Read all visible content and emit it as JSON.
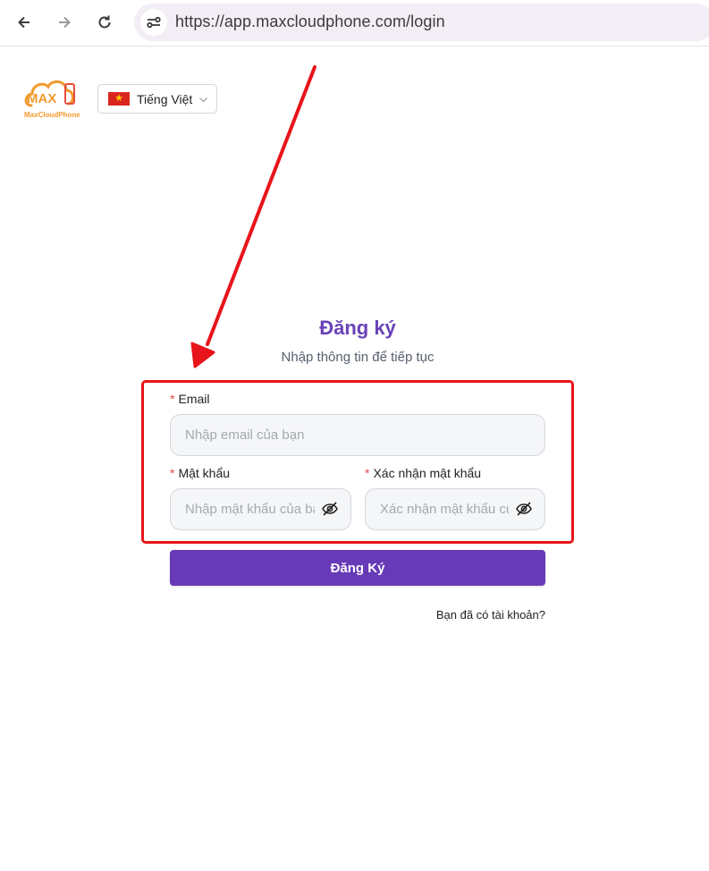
{
  "browser": {
    "url": "https://app.maxcloudphone.com/login"
  },
  "logo": {
    "badge": "MAX",
    "brand": "MaxCloudPhone"
  },
  "language": {
    "selected": "Tiếng Việt",
    "flag_star": "★"
  },
  "form": {
    "title": "Đăng ký",
    "subtitle": "Nhập thông tin để tiếp tục",
    "required_mark": "*",
    "email_label": "Email",
    "email_placeholder": "Nhập email của bạn",
    "password_label": "Mật khẩu",
    "password_placeholder": "Nhập mật khẩu của bạn",
    "confirm_label": "Xác nhận mật khẩu",
    "confirm_placeholder": "Xác nhận mật khẩu của bạn",
    "submit_label": "Đăng Ký",
    "login_link": "Bạn đã có tài khoản?"
  },
  "colors": {
    "accent": "#673ab7",
    "title": "#6a42b8",
    "annotation": "#e8141b"
  },
  "icons": [
    "back-arrow-icon",
    "forward-arrow-icon",
    "reload-icon",
    "site-settings-icon",
    "eye-off-icon",
    "chevron-down-icon"
  ]
}
